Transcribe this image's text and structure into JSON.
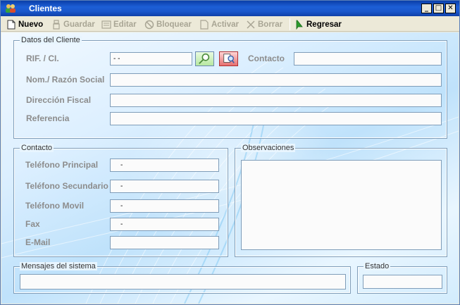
{
  "window": {
    "title": "Clientes"
  },
  "toolbar": {
    "nuevo": "Nuevo",
    "guardar": "Guardar",
    "editar": "Editar",
    "bloquear": "Bloquear",
    "activar": "Activar",
    "borrar": "Borrar",
    "regresar": "Regresar"
  },
  "datos_cliente": {
    "legend": "Datos del Cliente",
    "rif_label": "RIF. / CI.",
    "rif_value": " -        -",
    "contacto_label": "Contacto",
    "nombre_label": "Nom./ Razón Social",
    "direccion_label": "Dirección Fiscal",
    "referencia_label": "Referencia"
  },
  "contacto": {
    "legend": "Contacto",
    "tel_principal_label": "Teléfono Principal",
    "tel_principal_value": "-",
    "tel_secundario_label": "Teléfono Secundario",
    "tel_secundario_value": "-",
    "movil_label": "Teléfono Movil",
    "movil_value": "-",
    "fax_label": "Fax",
    "fax_value": "-",
    "email_label": "E-Mail"
  },
  "observaciones": {
    "legend": "Observaciones"
  },
  "mensajes": {
    "legend": "Mensajes del sistema"
  },
  "estado": {
    "legend": "Estado"
  },
  "icons": {
    "app": "users-icon",
    "nuevo": "new-document-icon",
    "guardar": "save-icon",
    "editar": "edit-icon",
    "bloquear": "block-icon",
    "activar": "activate-icon",
    "borrar": "delete-x-icon",
    "regresar": "back-arrow-icon",
    "search": "search-icon",
    "lookup": "lookup-icon"
  }
}
